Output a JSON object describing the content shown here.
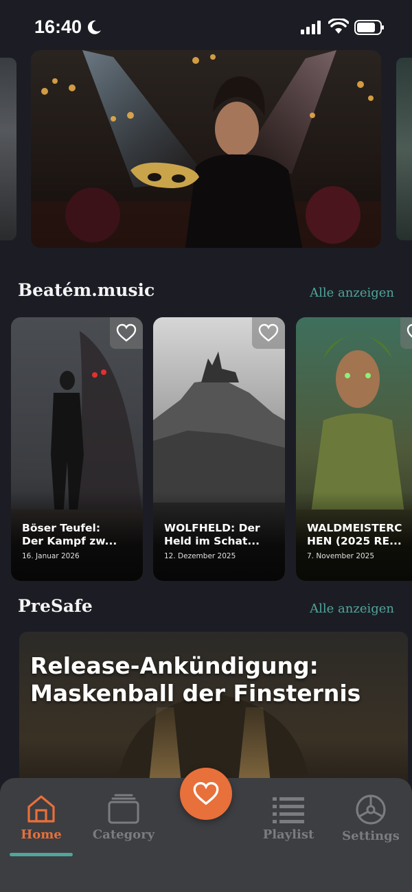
{
  "status_bar": {
    "time": "16:40"
  },
  "sections": [
    {
      "title": "Beatém.music",
      "see_all": "Alle anzeigen",
      "cards": [
        {
          "title": "Böser Teufel:\nDer Kampf zw...",
          "date": "16. Januar 2026"
        },
        {
          "title": "WOLFHELD: Der\nHeld im Schat...",
          "date": "12. Dezember 2025"
        },
        {
          "title": "WALDMEISTERC\nHEN (2025 RE...",
          "date": "7. November 2025"
        }
      ]
    },
    {
      "title": "PreSafe",
      "see_all": "Alle anzeigen",
      "banner_title": "Release-Ankündigung: Maskenball der Finsternis"
    }
  ],
  "nav": {
    "items": [
      {
        "label": "Home",
        "icon": "home-icon",
        "active": true
      },
      {
        "label": "Category",
        "icon": "category-icon",
        "active": false
      },
      {
        "label": "Playlist",
        "icon": "playlist-icon",
        "active": false
      },
      {
        "label": "Settings",
        "icon": "settings-icon",
        "active": false
      }
    ],
    "fab_icon": "heart-icon"
  },
  "colors": {
    "background": "#1c1d24",
    "accent": "#e8703a",
    "link": "#4fa69c",
    "nav_bg": "#3d3e42"
  }
}
